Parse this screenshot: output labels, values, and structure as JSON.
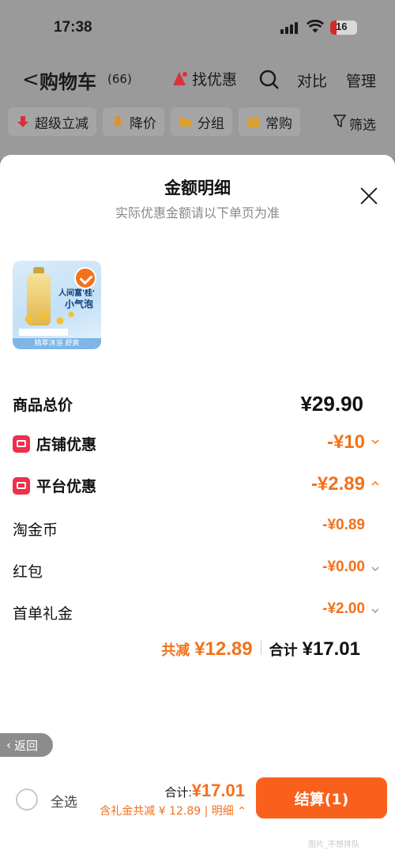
{
  "status_bar": {
    "time": "17:38",
    "battery": "16"
  },
  "nav": {
    "back": "<",
    "title": "购物车",
    "count": "(66)",
    "deals": "找优惠",
    "compare": "对比",
    "manage": "管理"
  },
  "chips": [
    {
      "label": "超级立减",
      "icon": "red-down-arrow-icon",
      "color": "#e0323b"
    },
    {
      "label": "降价",
      "icon": "orange-down-arrow-icon",
      "color": "#e8952b"
    },
    {
      "label": "分组",
      "icon": "folder-icon",
      "color": "#e8a62b"
    },
    {
      "label": "常购",
      "icon": "bag-icon",
      "color": "#e8a62b"
    }
  ],
  "filter": {
    "label": "筛选",
    "icon": "funnel-icon"
  },
  "sheet": {
    "title": "金额明细",
    "subtitle": "实际优惠金额请以下单页为准",
    "product": {
      "line1": "人间富'桂'",
      "line2": "小气泡",
      "band": "精萃沐浴  舒爽"
    },
    "rows": [
      {
        "label": "商品总价",
        "bold": true,
        "value": "¥29.90",
        "value_color": "#111",
        "chevron": "none"
      },
      {
        "label": "店铺优惠",
        "bold": true,
        "icon": "store-badge-icon",
        "value": "-¥10",
        "value_color": "#f3711a",
        "chevron": "down"
      },
      {
        "label": "平台优惠",
        "bold": true,
        "icon": "platform-badge-icon",
        "value": "-¥2.89",
        "value_color": "#f3711a",
        "chevron": "up"
      },
      {
        "label": "淘金币",
        "bold": false,
        "value": "-¥0.89",
        "value_color": "#f3711a",
        "chevron": "none"
      },
      {
        "label": "红包",
        "bold": false,
        "value": "-¥0.00",
        "value_color": "#f3711a",
        "chevron": "down"
      },
      {
        "label": "首单礼金",
        "bold": false,
        "value": "-¥2.00",
        "value_color": "#f3711a",
        "chevron": "down"
      }
    ],
    "total": {
      "discount_label": "共减",
      "discount_value": "¥12.89",
      "sum_label": "合计",
      "sum_value": "¥17.01"
    }
  },
  "back_button": "返回",
  "footer": {
    "select_all": "全选",
    "sum_label": "合计:",
    "sum_value": "¥17.01",
    "detail": "含礼金共减 ¥ 12.89 | 明细",
    "checkout": "结算(1)"
  },
  "watermark": "图片_不想排队"
}
